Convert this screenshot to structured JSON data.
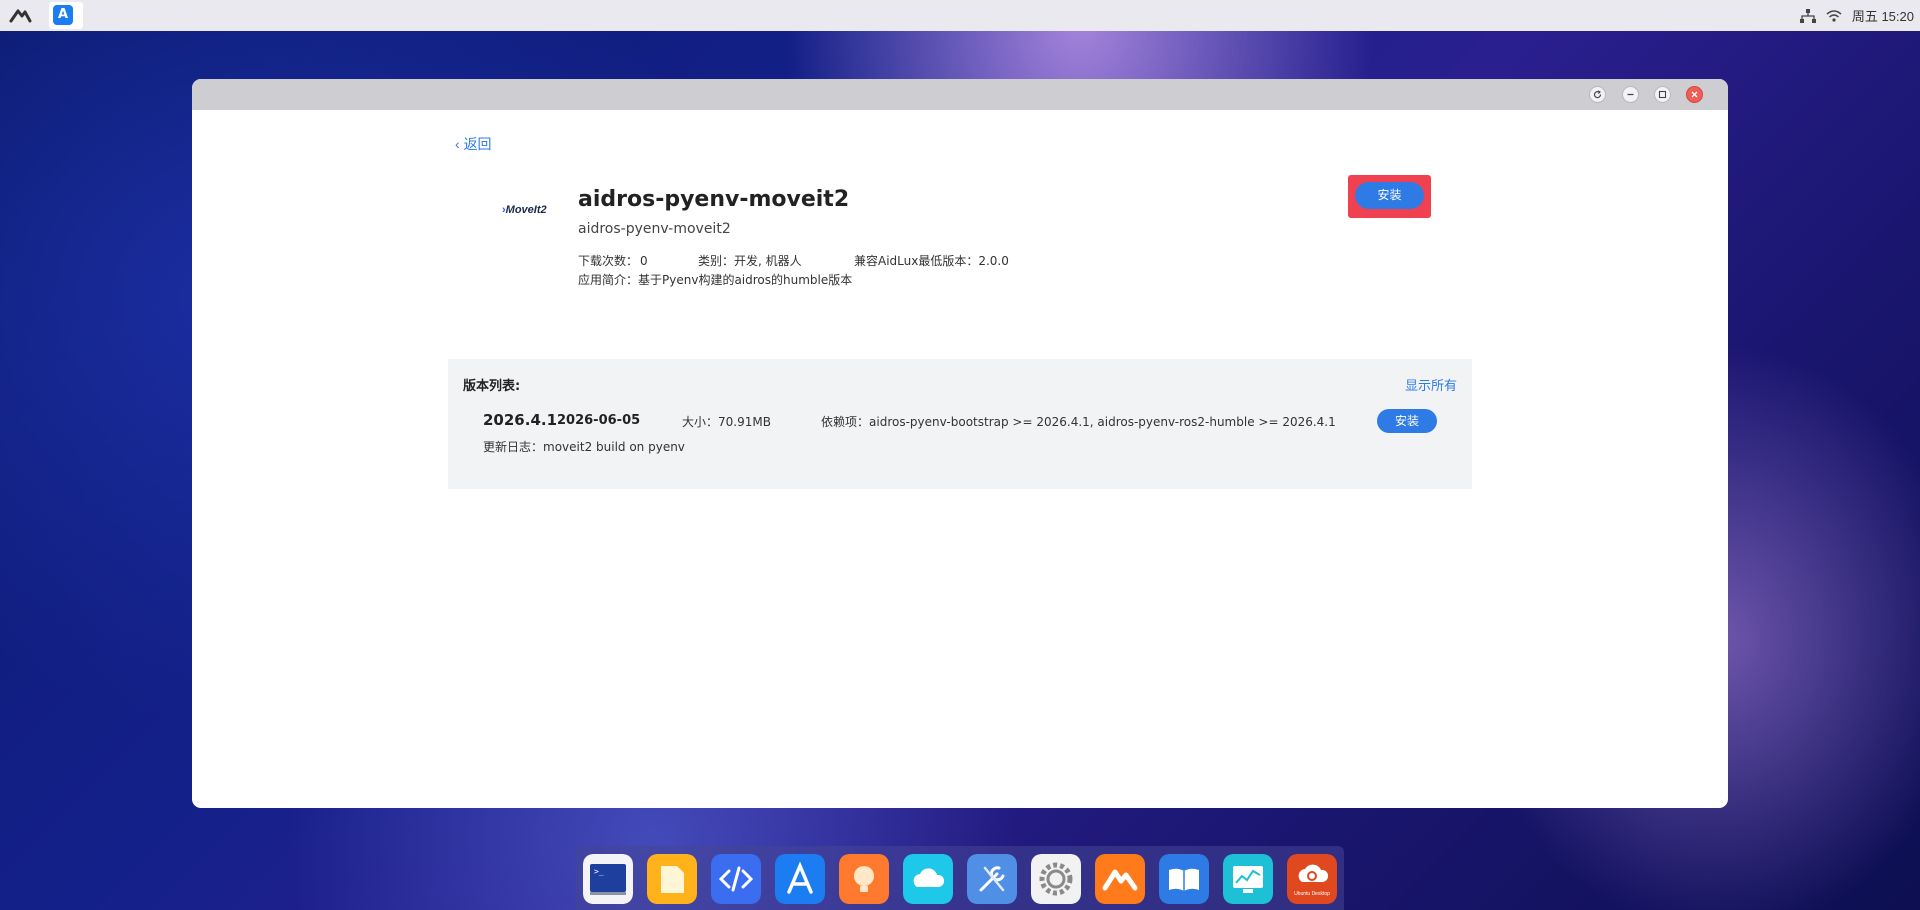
{
  "topbar": {
    "clock": "周五 15:20"
  },
  "window": {
    "back_label": "返回",
    "app": {
      "logo_text": "MoveIt2",
      "title": "aidros-pyenv-moveit2",
      "subtitle": "aidros-pyenv-moveit2",
      "downloads_label": "下载次数：",
      "downloads_value": "0",
      "category_label": "类别：",
      "category_value": "开发, 机器人",
      "compat_label": "兼容AidLux最低版本：",
      "compat_value": "2.0.0",
      "intro_label": "应用简介：",
      "intro_value": "基于Pyenv构建的aidros的humble版本",
      "install_label": "安装"
    },
    "versions": {
      "section_label": "版本列表:",
      "show_all_label": "显示所有",
      "items": [
        {
          "version": "2026.4.1",
          "date": "2026-06-05",
          "size_label": "大小：",
          "size_value": "70.91MB",
          "deps_label": "依赖项：",
          "deps_value": "aidros-pyenv-bootstrap >= 2026.4.1, aidros-pyenv-ros2-humble >= 2026.4.1",
          "install_label": "安装",
          "changelog_label": "更新日志：",
          "changelog_value": "moveit2 build on pyenv"
        }
      ]
    }
  },
  "dock": {
    "items": [
      "terminal-icon",
      "files-icon",
      "code-editor-icon",
      "app-store-icon",
      "tips-icon",
      "cloud-icon",
      "dev-tools-icon",
      "settings-icon",
      "aidlux-icon",
      "docs-icon",
      "system-monitor-icon",
      "ubuntu-desktop-icon"
    ],
    "ubuntu_label": "Ubuntu Desktop"
  },
  "colors": {
    "accent": "#2f7be6",
    "highlight": "#f04150",
    "close": "#f05d57"
  }
}
